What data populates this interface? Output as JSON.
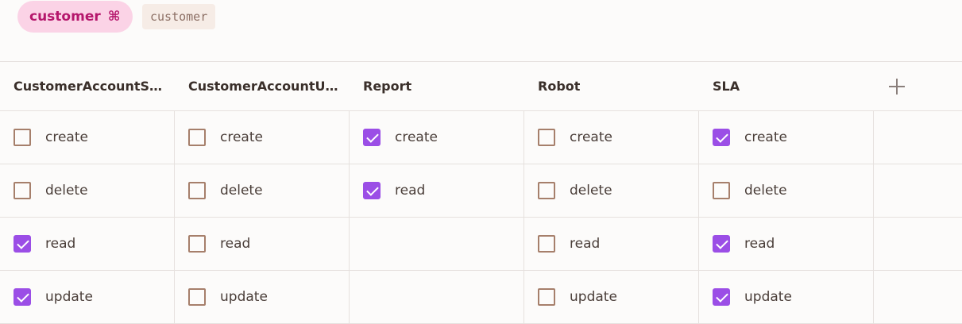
{
  "role": {
    "label": "customer",
    "shortcut_icon": "⌘"
  },
  "code_tag": "customer",
  "columns": [
    {
      "title": "CustomerAccountSetting",
      "perms": [
        {
          "label": "create",
          "checked": false
        },
        {
          "label": "delete",
          "checked": false
        },
        {
          "label": "read",
          "checked": true
        },
        {
          "label": "update",
          "checked": true
        }
      ]
    },
    {
      "title": "CustomerAccountUser",
      "perms": [
        {
          "label": "create",
          "checked": false
        },
        {
          "label": "delete",
          "checked": false
        },
        {
          "label": "read",
          "checked": false
        },
        {
          "label": "update",
          "checked": false
        }
      ]
    },
    {
      "title": "Report",
      "perms": [
        {
          "label": "create",
          "checked": true
        },
        {
          "label": "read",
          "checked": true
        }
      ]
    },
    {
      "title": "Robot",
      "perms": [
        {
          "label": "create",
          "checked": false
        },
        {
          "label": "delete",
          "checked": false
        },
        {
          "label": "read",
          "checked": false
        },
        {
          "label": "update",
          "checked": false
        }
      ]
    },
    {
      "title": "SLA",
      "perms": [
        {
          "label": "create",
          "checked": true
        },
        {
          "label": "delete",
          "checked": false
        },
        {
          "label": "read",
          "checked": true
        },
        {
          "label": "update",
          "checked": true
        }
      ]
    }
  ],
  "add_column_icon": "plus-icon",
  "colors": {
    "checkbox_checked": "#9b4ee6",
    "checkbox_border": "#a67f6b",
    "pill_bg": "#fbd3e6",
    "pill_text": "#b5176c"
  }
}
